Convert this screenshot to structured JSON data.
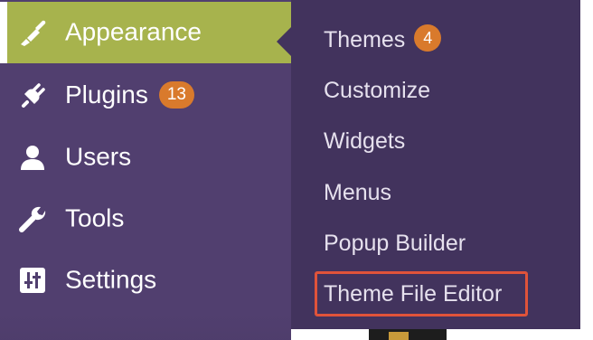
{
  "sidebar": {
    "items": [
      {
        "label": "Appearance",
        "icon": "paintbrush-icon",
        "active": true
      },
      {
        "label": "Plugins",
        "icon": "plugin-plug-icon",
        "badge": "13"
      },
      {
        "label": "Users",
        "icon": "user-icon"
      },
      {
        "label": "Tools",
        "icon": "wrench-icon"
      },
      {
        "label": "Settings",
        "icon": "sliders-settings-icon"
      }
    ]
  },
  "submenu": {
    "items": [
      {
        "label": "Themes",
        "badge": "4"
      },
      {
        "label": "Customize"
      },
      {
        "label": "Widgets"
      },
      {
        "label": "Menus"
      },
      {
        "label": "Popup Builder"
      },
      {
        "label": "Theme File Editor",
        "highlighted": true
      }
    ]
  },
  "colors": {
    "sidebar_bg": "#513f6f",
    "active_bg": "#a7b34d",
    "flyout_bg": "#42335d",
    "badge_bg": "#d97a2c",
    "highlight_border": "#e0533a"
  }
}
